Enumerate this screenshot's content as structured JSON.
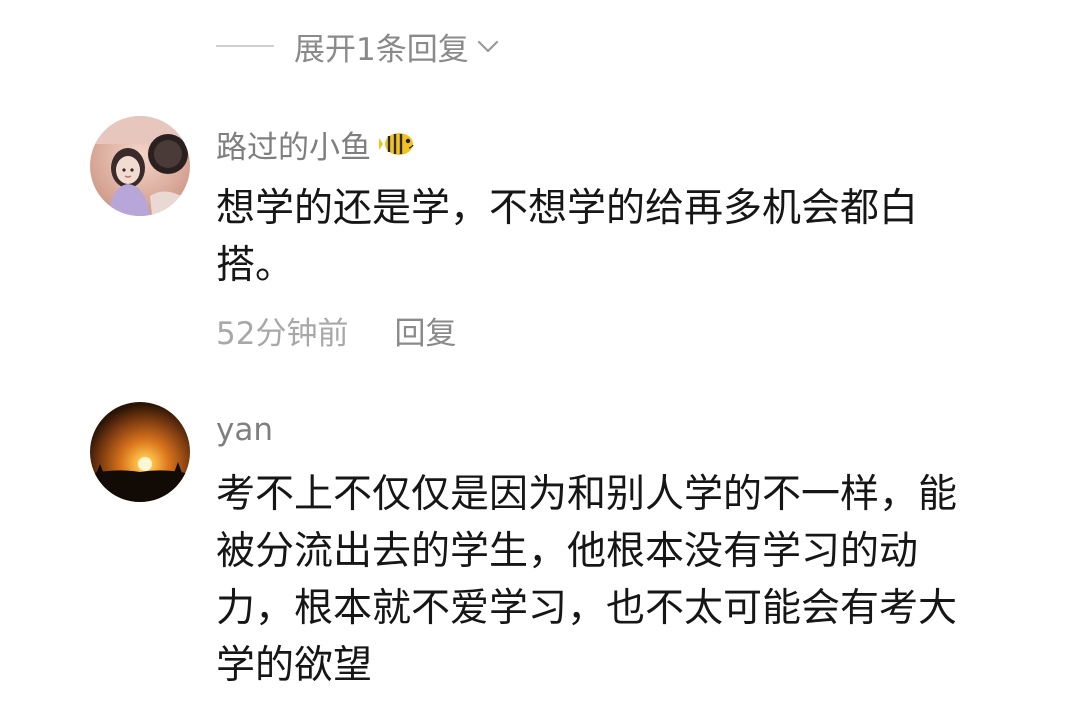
{
  "thread": {
    "expand_replies_label": "展开1条回复"
  },
  "comments": [
    {
      "username": "路过的小鱼",
      "username_badge_icon": "fish-icon",
      "text": "想学的还是学，不想学的给再多机会都白\n搭。",
      "time": "52分钟前",
      "reply_label": "回复"
    },
    {
      "username": "yan",
      "text": "考不上不仅仅是因为和别人学的不一样，能\n被分流出去的学生，他根本没有学习的动\n力，根本就不爱学习，也不太可能会有考大\n学的欲望"
    }
  ],
  "colors": {
    "meta_text": "#8a8a8a",
    "body_text": "#161616",
    "timestamp": "#a8a8a8"
  }
}
